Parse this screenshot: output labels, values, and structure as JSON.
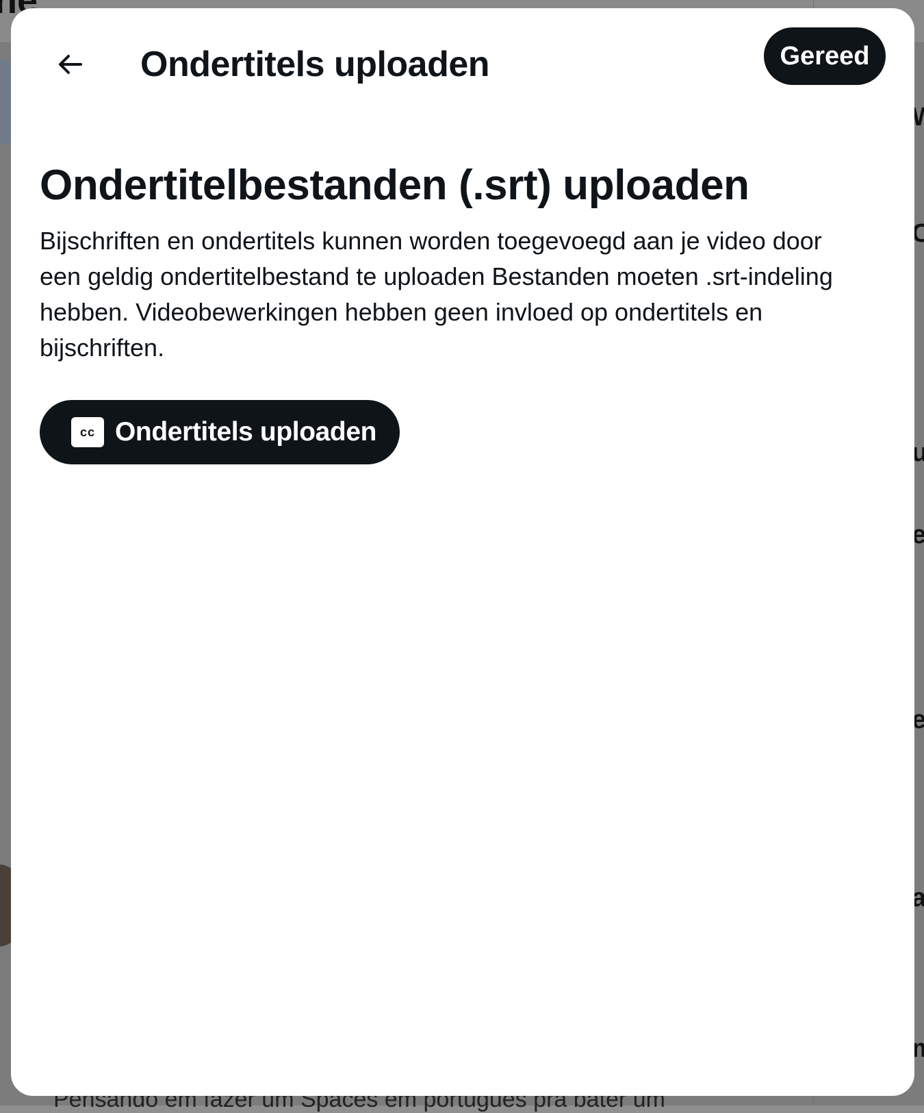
{
  "background": {
    "topbar_title": "ne",
    "bottom_text": "Pensando em fazer um Spaces em português pra bater um"
  },
  "modal": {
    "title": "Ondertitels uploaden",
    "done_label": "Gereed",
    "back_icon": "arrow-left-icon"
  },
  "content": {
    "heading": "Ondertitelbestanden (.srt) uploaden",
    "description": "Bijschriften en ondertitels kunnen worden toegevoegd aan je video door een geldig ondertitelbestand te uploaden Bestanden moeten .srt-indeling hebben. Videobewerkingen hebben geen invloed op ondertitels en bijschriften.",
    "upload_button": {
      "icon": "closed-captions-icon",
      "icon_text": "cc",
      "label": "Ondertitels uploaden"
    }
  },
  "colors": {
    "primary_button": "#0f1419",
    "modal_background": "#ffffff",
    "overlay": "#7c7c7c"
  }
}
